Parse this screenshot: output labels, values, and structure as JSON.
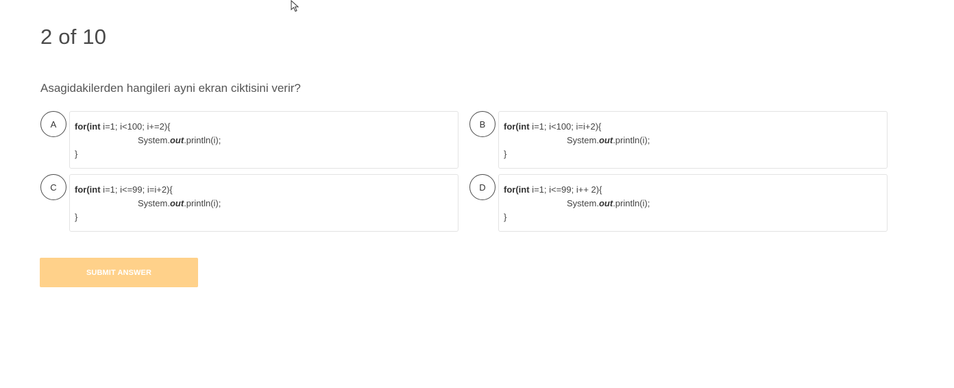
{
  "progress": {
    "text": "2 of 10"
  },
  "question": {
    "text": "Asagidakilerden hangileri ayni ekran ciktisini verir?"
  },
  "options": [
    {
      "letter": "A",
      "line1_kw1": "for",
      "line1_kw2": "(int",
      "line1_rest": " i=1; i<100; i+=2){",
      "line2_pre": "System.",
      "line2_field": "out",
      "line2_post": ".println(i);",
      "line3": "}"
    },
    {
      "letter": "B",
      "line1_kw1": "for",
      "line1_kw2": "(int",
      "line1_rest": " i=1; i<100; i=i+2){",
      "line2_pre": "System.",
      "line2_field": "out",
      "line2_post": ".println(i);",
      "line3": "}"
    },
    {
      "letter": "C",
      "line1_kw1": "for",
      "line1_kw2": "(int",
      "line1_rest": " i=1; i<=99; i=i+2){",
      "line2_pre": "System.",
      "line2_field": "out",
      "line2_post": ".println(i);",
      "line3": "}"
    },
    {
      "letter": "D",
      "line1_kw1": "for",
      "line1_kw2": "(int",
      "line1_rest": " i=1; i<=99; i++ 2){",
      "line2_pre": "System.",
      "line2_field": "out",
      "line2_post": ".println(i);",
      "line3": "}"
    }
  ],
  "submit": {
    "label": "SUBMIT ANSWER",
    "color": "#ffd18a"
  },
  "cursor": {
    "icon": "mouse-pointer-icon"
  }
}
